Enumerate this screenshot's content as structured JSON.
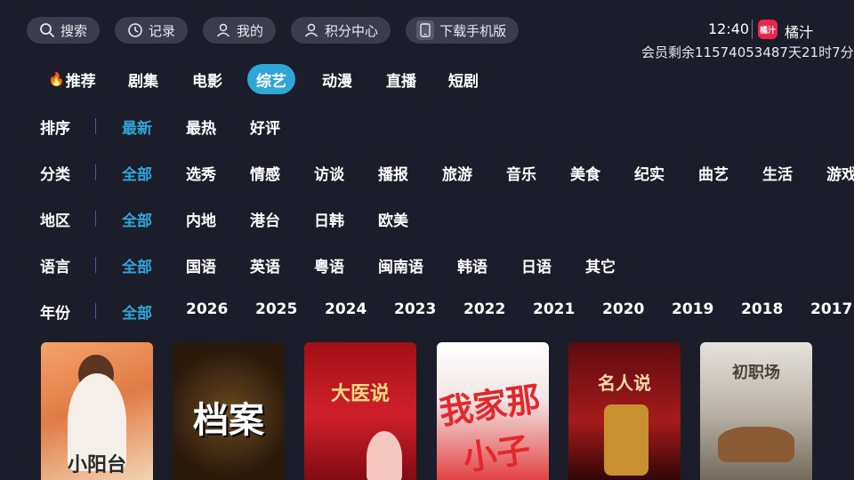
{
  "topbar": {
    "search": "搜索",
    "history": "记录",
    "mine": "我的",
    "points": "积分中心",
    "download": "下载手机版"
  },
  "status": {
    "time": "12:40",
    "app_logo_text": "橘汁",
    "app_name": "橘汁",
    "membership": "会员剩余11574053487天21时7分"
  },
  "nav_tabs": [
    "推荐",
    "剧集",
    "电影",
    "综艺",
    "动漫",
    "直播",
    "短剧"
  ],
  "active_tab": "综艺",
  "filters": {
    "sort": {
      "label": "排序",
      "options": [
        "最新",
        "最热",
        "好评"
      ],
      "selected": "最新"
    },
    "category": {
      "label": "分类",
      "options": [
        "全部",
        "选秀",
        "情感",
        "访谈",
        "播报",
        "旅游",
        "音乐",
        "美食",
        "纪实",
        "曲艺",
        "生活",
        "游戏"
      ],
      "selected": "全部"
    },
    "region": {
      "label": "地区",
      "options": [
        "全部",
        "内地",
        "港台",
        "日韩",
        "欧美"
      ],
      "selected": "全部"
    },
    "language": {
      "label": "语言",
      "options": [
        "全部",
        "国语",
        "英语",
        "粤语",
        "闽南语",
        "韩语",
        "日语",
        "其它"
      ],
      "selected": "全部"
    },
    "year": {
      "label": "年份",
      "options": [
        "全部",
        "2026",
        "2025",
        "2024",
        "2023",
        "2022",
        "2021",
        "2020",
        "2019",
        "2018",
        "2017"
      ],
      "selected": "全部"
    }
  },
  "posters": [
    {
      "title": "小阳台"
    },
    {
      "title": "档案"
    },
    {
      "title": "大医说"
    },
    {
      "title": "我家那小子"
    },
    {
      "title": "名人说"
    },
    {
      "title": "初职场"
    }
  ],
  "colors": {
    "background": "#1b1d2a",
    "accent": "#2ea7d8",
    "pill": "#3a3d4b",
    "logo": "#e8254a"
  }
}
